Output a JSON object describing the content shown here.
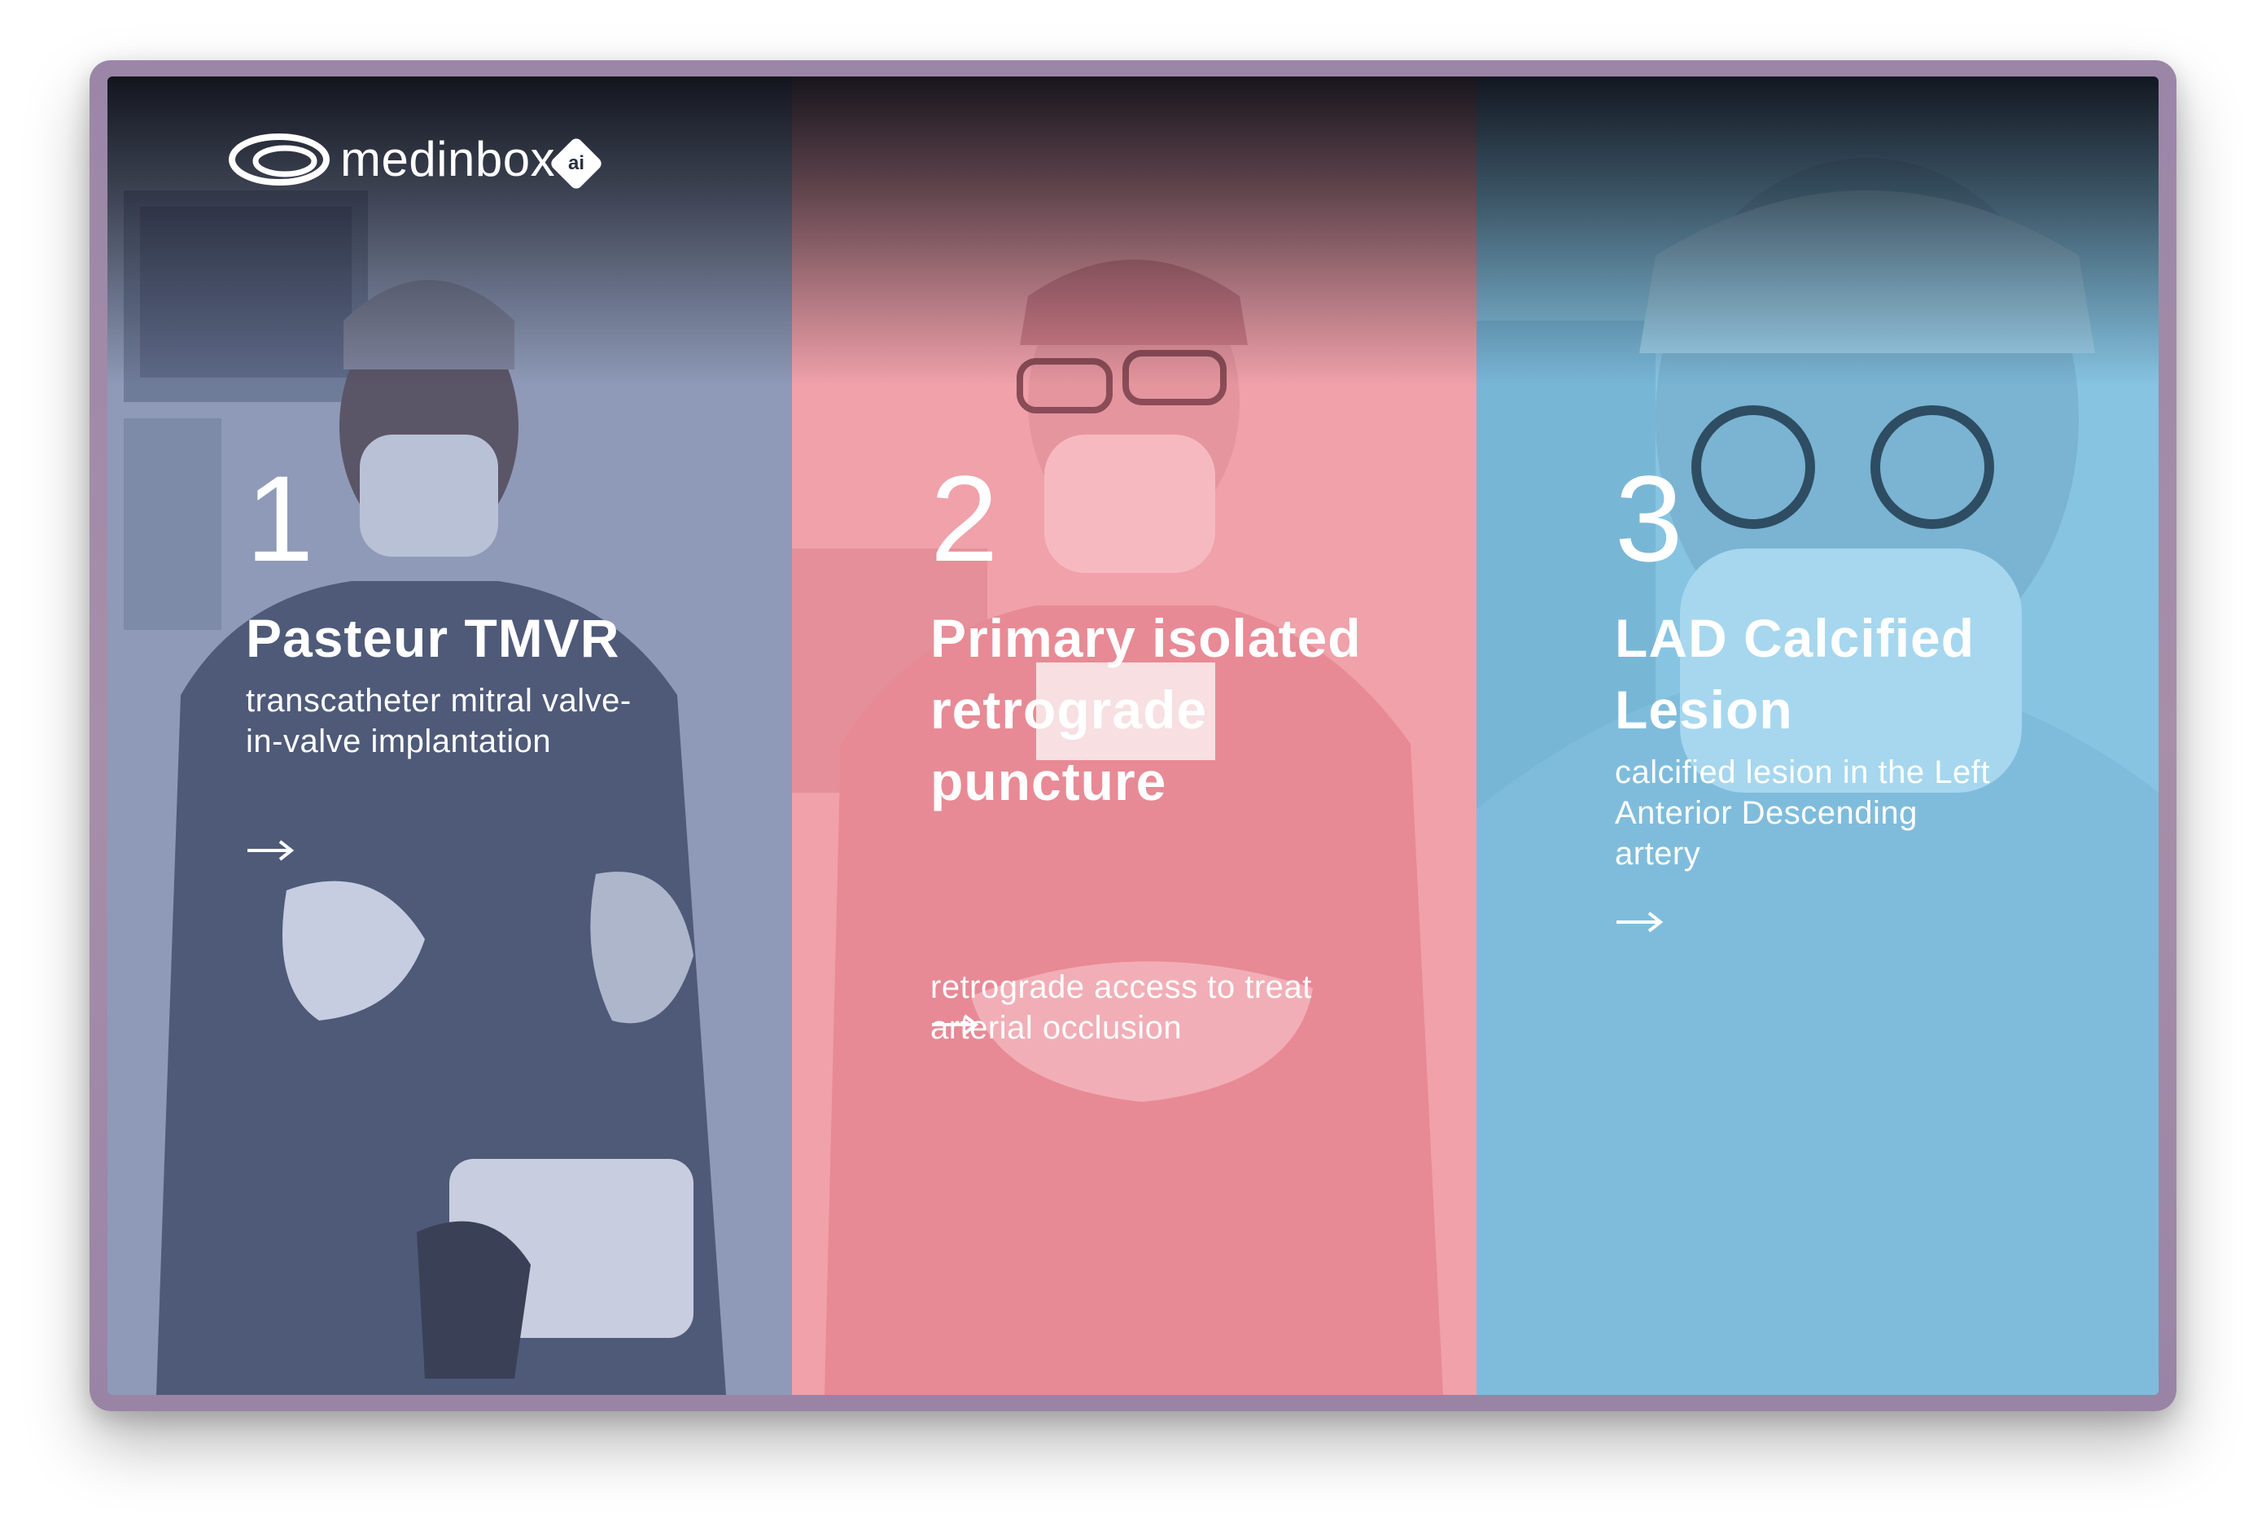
{
  "brand": {
    "name": "medinbox",
    "badge": "ai",
    "icon": "medinbox-logo-icon"
  },
  "cards": [
    {
      "number": "1",
      "title": "Pasteur TMVR",
      "description": "transcatheter mitral valve-in-valve implantation",
      "icon": "arrow-right-icon",
      "color": "#8e9ab7"
    },
    {
      "number": "2",
      "title": "Primary isolated retrograde puncture",
      "description": "retrograde access to treat arterial occlusion",
      "icon": "arrow-right-icon",
      "color": "#f0a1aa"
    },
    {
      "number": "3",
      "title": "LAD Calcified Lesion",
      "description": "calcified lesion in the Left Anterior Descending artery",
      "icon": "arrow-right-icon",
      "color": "#86c4e2"
    }
  ]
}
